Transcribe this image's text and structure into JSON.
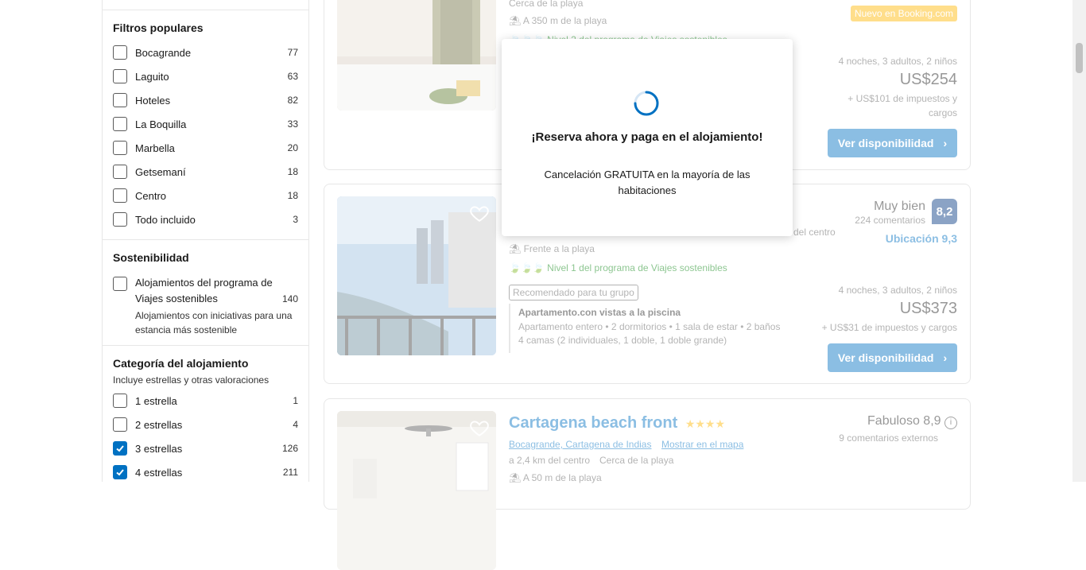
{
  "sidebar": {
    "popular": {
      "title": "Filtros populares",
      "items": [
        {
          "label": "Bocagrande",
          "count": "77",
          "checked": false
        },
        {
          "label": "Laguito",
          "count": "63",
          "checked": false
        },
        {
          "label": "Hoteles",
          "count": "82",
          "checked": false
        },
        {
          "label": "La Boquilla",
          "count": "33",
          "checked": false
        },
        {
          "label": "Marbella",
          "count": "20",
          "checked": false
        },
        {
          "label": "Getsemaní",
          "count": "18",
          "checked": false
        },
        {
          "label": "Centro",
          "count": "18",
          "checked": false
        },
        {
          "label": "Todo incluido",
          "count": "3",
          "checked": false
        }
      ]
    },
    "sustainability": {
      "title": "Sostenibilidad",
      "item_line1": "Alojamientos del programa de",
      "item_line2": "Viajes sostenibles",
      "count": "140",
      "desc": "Alojamientos con iniciativas para una estancia más sostenible"
    },
    "category": {
      "title": "Categoría del alojamiento",
      "subtitle": "Incluye estrellas y otras valoraciones",
      "items": [
        {
          "label": "1 estrella",
          "count": "1",
          "checked": false
        },
        {
          "label": "2 estrellas",
          "count": "4",
          "checked": false
        },
        {
          "label": "3 estrellas",
          "count": "126",
          "checked": true
        },
        {
          "label": "4 estrellas",
          "count": "211",
          "checked": true
        }
      ]
    }
  },
  "cards": {
    "c1": {
      "near_beach": "Cerca de la playa",
      "beach_distance": "A 350 m de la playa",
      "sustain_level": "Nivel 2 del programa de Viajes sostenibles",
      "new_badge": "Nuevo en Booking.com",
      "stay": "4 noches, 3 adultos, 2 niños",
      "price": "US$254",
      "taxes_line1": "+ US$101 de impuestos y",
      "taxes_line2": "cargos",
      "button": "Ver disponibilidad"
    },
    "c2": {
      "score_word": "Muy bien",
      "reviews": "224 comentarios",
      "score": "8,2",
      "location_score": "Ubicación 9,3",
      "center_frag": "del centro",
      "beach": "Frente a la playa",
      "sustain_level": "Nivel 1 del programa de Viajes sostenibles",
      "recommended": "Recomendado para tu grupo",
      "room_title": "Apartamento.con vistas a la piscina",
      "room_desc": "Apartamento entero • 2 dormitorios • 1 sala de estar • 2 baños",
      "beds": "4 camas (2 individuales, 1 doble, 1 doble grande)",
      "stay": "4 noches, 3 adultos, 2 niños",
      "price": "US$373",
      "taxes": "+ US$31 de impuestos y cargos",
      "button": "Ver disponibilidad"
    },
    "c3": {
      "title": "Cartagena beach front",
      "location": "Bocagrande, Cartagena de Indias",
      "map_link": "Mostrar en el mapa",
      "distance": "a 2,4 km del centro",
      "near_beach": "Cerca de la playa",
      "beach_distance": "A 50 m de la playa",
      "score_text": "Fabuloso 8,9",
      "external": "9 comentarios externos"
    }
  },
  "modal": {
    "title": "¡Reserva ahora y paga en el alojamiento!",
    "text": "Cancelación GRATUITA en la mayoría de las habitaciones"
  },
  "colors": {
    "brand_blue": "#0071c2",
    "dark_blue": "#003580",
    "green": "#008009",
    "yellow": "#ffb700"
  }
}
